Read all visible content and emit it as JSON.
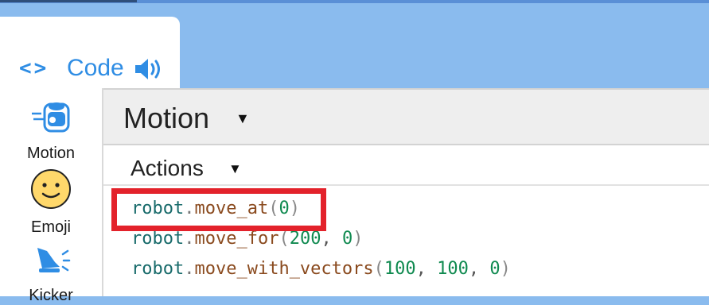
{
  "header_tab": {
    "label": "Code",
    "brackets_glyph": "<>",
    "speaker_icon": "speaker-icon"
  },
  "sidebar": {
    "items": [
      {
        "label": "Motion",
        "icon": "robot-motion-icon"
      },
      {
        "label": "Emoji",
        "icon": "smiley-icon"
      },
      {
        "label": "Kicker",
        "icon": "kicker-shoe-icon"
      }
    ]
  },
  "main": {
    "title": "Motion",
    "section": "Actions",
    "code_lines": [
      {
        "obj": "robot",
        "dot": ".",
        "fn": "move_at",
        "open": "(",
        "args": [
          "0"
        ],
        "close": ")"
      },
      {
        "obj": "robot",
        "dot": ".",
        "fn": "move_for",
        "open": "(",
        "args": [
          "200",
          "0"
        ],
        "close": ")"
      },
      {
        "obj": "robot",
        "dot": ".",
        "fn": "move_with_vectors",
        "open": "(",
        "args": [
          "100",
          "100",
          "0"
        ],
        "close": ")"
      }
    ],
    "comma": ", "
  },
  "colors": {
    "accent": "#2f8de4",
    "background": "#8abbee",
    "highlight": "#e3222b"
  }
}
